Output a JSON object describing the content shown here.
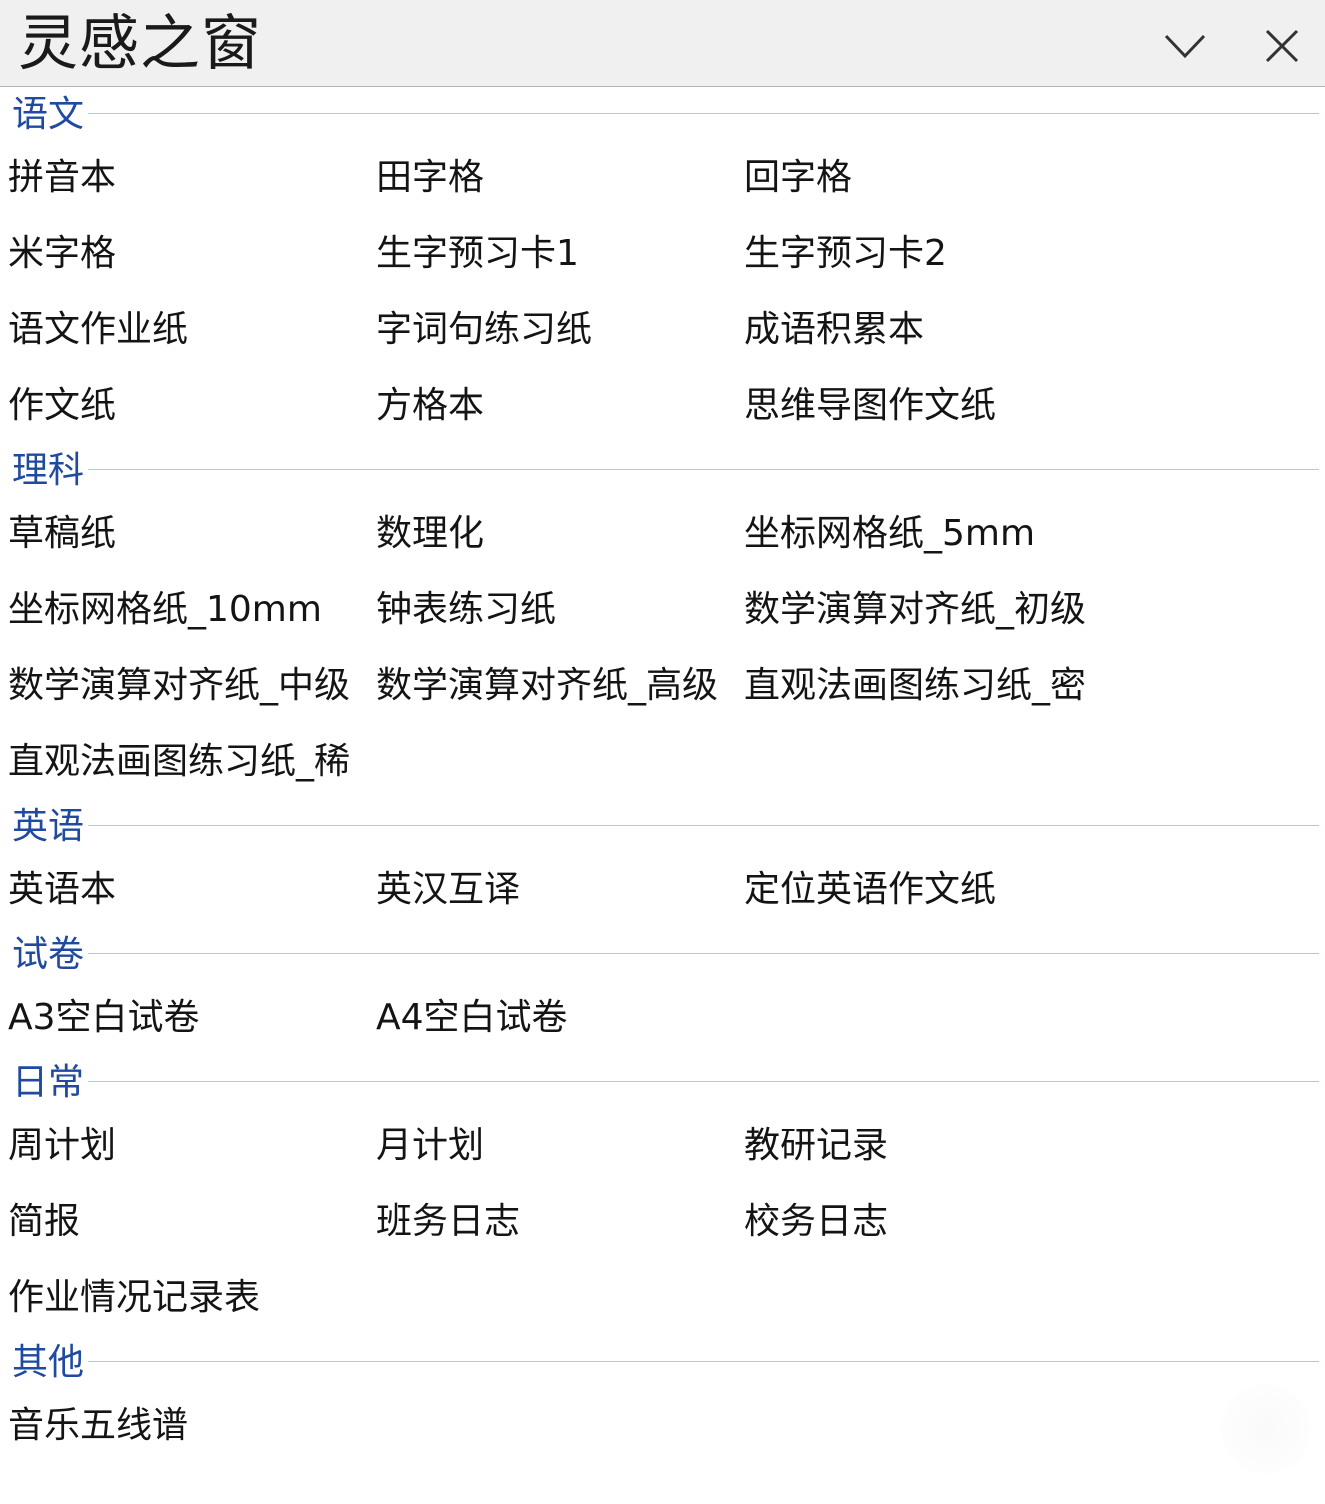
{
  "window": {
    "title": "灵感之窗",
    "minimize_icon": "chevron-down-icon",
    "close_icon": "close-icon"
  },
  "sections": [
    {
      "label": "语文",
      "items": [
        "拼音本",
        "田字格",
        "回字格",
        "米字格",
        "生字预习卡1",
        "生字预习卡2",
        "语文作业纸",
        "字词句练习纸",
        "成语积累本",
        "作文纸",
        "方格本",
        "思维导图作文纸"
      ]
    },
    {
      "label": "理科",
      "items": [
        "草稿纸",
        "数理化",
        "坐标网格纸_5mm",
        "坐标网格纸_10mm",
        "钟表练习纸",
        "数学演算对齐纸_初级",
        "数学演算对齐纸_中级",
        "数学演算对齐纸_高级",
        "直观法画图练习纸_密",
        "直观法画图练习纸_稀"
      ]
    },
    {
      "label": "英语",
      "items": [
        "英语本",
        "英汉互译",
        "定位英语作文纸"
      ]
    },
    {
      "label": "试卷",
      "items": [
        "A3空白试卷",
        "A4空白试卷"
      ]
    },
    {
      "label": "日常",
      "items": [
        "周计划",
        "月计划",
        "教研记录",
        "简报",
        "班务日志",
        "校务日志",
        "作业情况记录表"
      ]
    },
    {
      "label": "其他",
      "items": [
        "音乐五线谱"
      ]
    }
  ],
  "colors": {
    "section_label": "#1f4aa0",
    "section_rule": "#b7c7dc",
    "titlebar_bg": "#f0f0f0"
  }
}
